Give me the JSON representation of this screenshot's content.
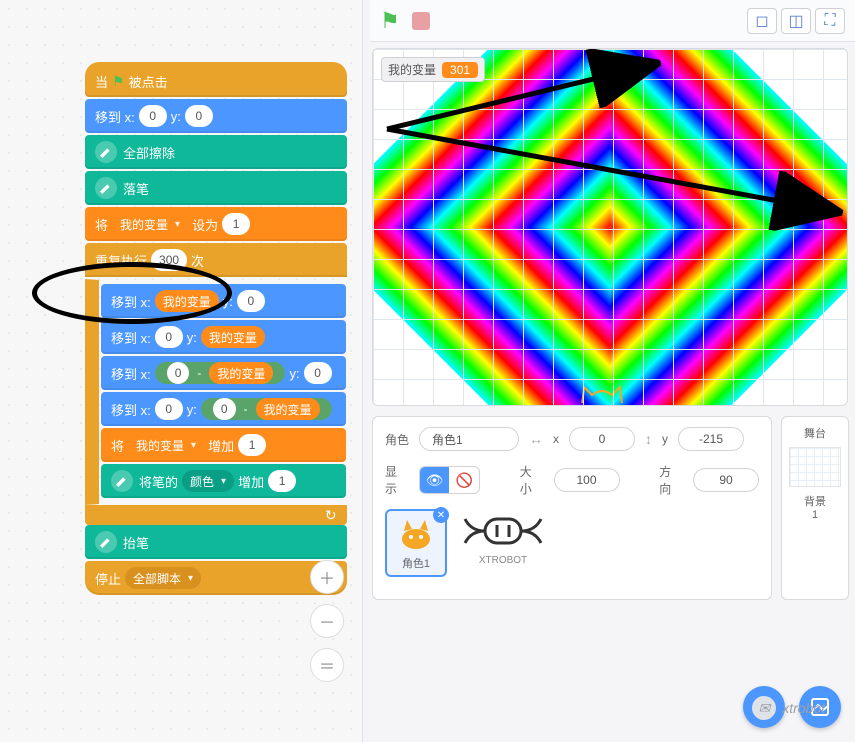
{
  "toolbar": {
    "layout1_icon": "layout-small-icon",
    "layout2_icon": "layout-large-icon",
    "layout3_icon": "fullscreen-icon"
  },
  "stage": {
    "variable_label": "我的变量",
    "variable_value": "301"
  },
  "blocks": {
    "when_flag": {
      "pre": "当",
      "post": "被点击"
    },
    "goto1": {
      "pre": "移到 x:",
      "x": "0",
      "mid": "y:",
      "y": "0"
    },
    "erase_all": "全部擦除",
    "pen_down": "落笔",
    "set_var": {
      "pre": "将",
      "var": "我的变量",
      "mid": "设为",
      "val": "1"
    },
    "repeat": {
      "pre": "重复执行",
      "times": "300",
      "post": "次"
    },
    "goto_a": {
      "pre": "移到 x:",
      "xvar": "我的变量",
      "mid": "y:",
      "y": "0"
    },
    "goto_b": {
      "pre": "移到 x:",
      "x": "0",
      "mid": "y:",
      "yvar": "我的变量"
    },
    "goto_c": {
      "pre": "移到 x:",
      "x0": "0",
      "minus": "-",
      "xvar": "我的变量",
      "mid": "y:",
      "y": "0"
    },
    "goto_d": {
      "pre": "移到 x:",
      "x": "0",
      "mid": "y:",
      "y0": "0",
      "minus": "-",
      "yvar": "我的变量"
    },
    "change_var": {
      "pre": "将",
      "var": "我的变量",
      "mid": "增加",
      "val": "1"
    },
    "change_pen": {
      "pre": "将笔的",
      "attr": "颜色",
      "mid": "增加",
      "val": "1"
    },
    "pen_up": "抬笔",
    "stop": {
      "pre": "停止",
      "what": "全部脚本"
    }
  },
  "sprite_info": {
    "name_label": "角色",
    "name_value": "角色1",
    "x_label": "x",
    "x_value": "0",
    "y_label": "y",
    "y_value": "-215",
    "show_label": "显示",
    "size_label": "大小",
    "size_value": "100",
    "dir_label": "方向",
    "dir_value": "90"
  },
  "thumbs": {
    "sprite1": "角色1",
    "xtrobot": "XTROBOT"
  },
  "backdrop": {
    "title": "舞台",
    "label": "背景",
    "count": "1"
  },
  "watermark": "xtrobot"
}
